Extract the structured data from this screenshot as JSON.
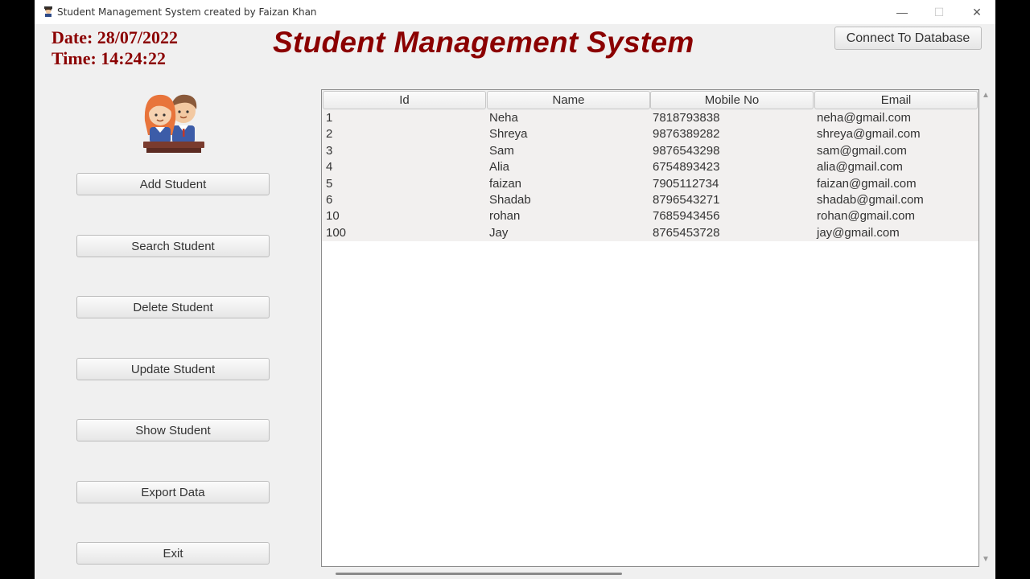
{
  "window": {
    "title": "Student Management System created by Faizan Khan",
    "icon": "student-icon",
    "controls": {
      "minimize": "—",
      "maximize": "☐",
      "close": "✕"
    }
  },
  "header": {
    "date": "Date: 28/07/2022",
    "time": "Time: 14:24:22",
    "title": "Student Management System",
    "connect_label": "Connect To Database"
  },
  "colors": {
    "accent": "#8b0000",
    "window_bg": "#f0f0f0"
  },
  "sidebar": {
    "logo": "students-illustration",
    "buttons": [
      {
        "label": "Add Student"
      },
      {
        "label": "Search Student"
      },
      {
        "label": "Delete Student"
      },
      {
        "label": "Update Student"
      },
      {
        "label": "Show Student"
      },
      {
        "label": "Export Data"
      },
      {
        "label": "Exit"
      }
    ]
  },
  "table": {
    "columns": [
      "Id",
      "Name",
      "Mobile No",
      "Email"
    ],
    "rows": [
      [
        "1",
        "Neha",
        "7818793838",
        "neha@gmail.com"
      ],
      [
        "2",
        "Shreya",
        "9876389282",
        "shreya@gmail.com"
      ],
      [
        "3",
        "Sam",
        "9876543298",
        "sam@gmail.com"
      ],
      [
        "4",
        "Alia",
        "6754893423",
        "alia@gmail.com"
      ],
      [
        "5",
        "faizan",
        "7905112734",
        "faizan@gmail.com"
      ],
      [
        "6",
        "Shadab",
        "8796543271",
        "shadab@gmail.com"
      ],
      [
        "10",
        "rohan",
        "7685943456",
        "rohan@gmail.com"
      ],
      [
        "100",
        "Jay",
        "8765453728",
        "jay@gmail.com"
      ]
    ]
  }
}
